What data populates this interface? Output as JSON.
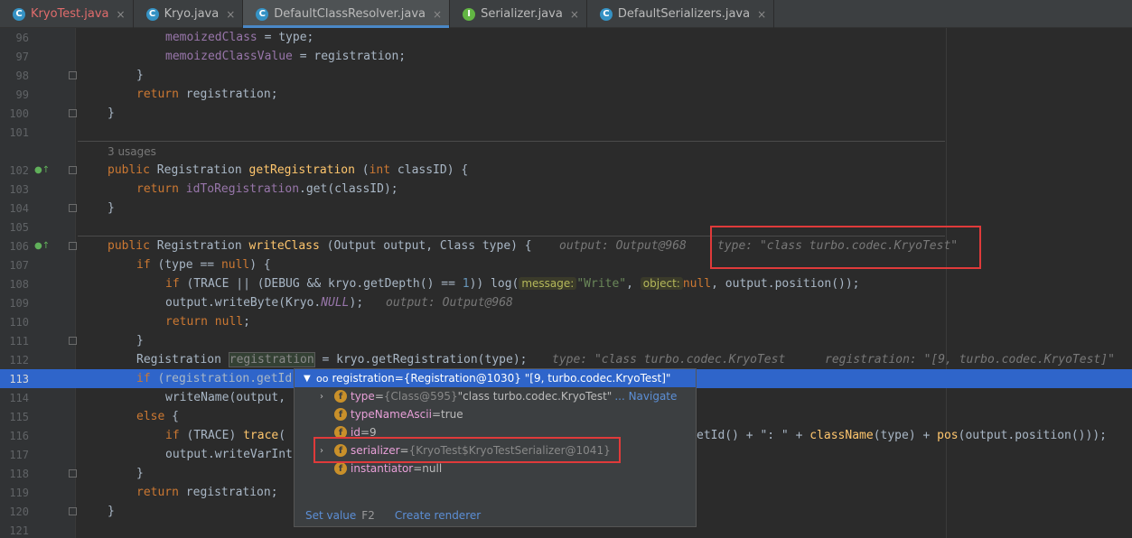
{
  "tabs": [
    {
      "label": "KryoTest.java",
      "icon": "C",
      "kind": "class",
      "error": true,
      "active": false
    },
    {
      "label": "Kryo.java",
      "icon": "C",
      "kind": "class",
      "error": false,
      "active": false
    },
    {
      "label": "DefaultClassResolver.java",
      "icon": "C",
      "kind": "class",
      "error": false,
      "active": true
    },
    {
      "label": "Serializer.java",
      "icon": "I",
      "kind": "interface",
      "error": false,
      "active": false
    },
    {
      "label": "DefaultSerializers.java",
      "icon": "C",
      "kind": "class",
      "error": false,
      "active": false
    }
  ],
  "tab_close_glyph": "×",
  "lines": {
    "96": "96",
    "97": "97",
    "98": "98",
    "99": "99",
    "100": "100",
    "101": "101",
    "102": "102",
    "103": "103",
    "104": "104",
    "105": "105",
    "106": "106",
    "107": "107",
    "108": "108",
    "109": "109",
    "110": "110",
    "111": "111",
    "112": "112",
    "113": "113",
    "114": "114",
    "115": "115",
    "116": "116",
    "117": "117",
    "118": "118",
    "119": "119",
    "120": "120",
    "121": "121"
  },
  "code": {
    "l96": {
      "a": "memoizedClass",
      "b": " = ",
      "c": "type",
      "d": ";"
    },
    "l97": {
      "a": "memoizedClassValue",
      "b": " = ",
      "c": "registration",
      "d": ";"
    },
    "l98": "}",
    "l99": {
      "kw": "return",
      "rest": " registration;"
    },
    "l100": "}",
    "usages": "3 usages",
    "l102": {
      "kw": "public",
      "t": " Registration ",
      "fn": "getRegistration",
      "p1": " (",
      "kw2": "int",
      "p2": " classID) {"
    },
    "l103": {
      "kw": "return",
      "sp": " ",
      "fld": "idToRegistration",
      "rest": ".get(classID);"
    },
    "l104": "}",
    "l106": {
      "kw": "public",
      "t": " Registration ",
      "fn": "writeClass",
      "p": " (Output output, Class type) {",
      "hint1": "output: Output@968",
      "hint2": "type: \"class turbo.codec.KryoTest\""
    },
    "l107": {
      "kw": "if",
      "p1": " (type == ",
      "kw2": "null",
      "p2": ") {"
    },
    "l108": {
      "kw": "if",
      "p1": " (TRACE || (DEBUG && kryo.getDepth() == ",
      "num": "1",
      "p2": ")) log(",
      "ph1": "message:",
      "str1": "\"Write\"",
      "c": ", ",
      "ph2": "object:",
      "kw2": "null",
      "p3": ", output.position());"
    },
    "l109": {
      "p1": "output.writeByte(Kryo.",
      "stat": "NULL",
      "p2": ");",
      "hint": "output: Output@968"
    },
    "l110": {
      "kw": "return",
      "sp": " ",
      "kw2": "null",
      "p": ";"
    },
    "l111": "}",
    "l112": {
      "t": "Registration ",
      "hl": "registration",
      "p": " = kryo.getRegistration(type);",
      "hint1": "type: \"class turbo.codec.KryoTest",
      "hint2": "registration: \"[9, turbo.codec.KryoTest]\""
    },
    "l113": {
      "kw": "if",
      "p": " (registration.getId"
    },
    "l114": "writeName(output,",
    "l115": {
      "kw": "else",
      "p": " {"
    },
    "l116": {
      "kw": "if",
      "p1": " (TRACE) ",
      "fn": "trace",
      "p2": "(",
      "tail": "etId() + \": \" + ",
      "fn2": "className",
      "tail2": "(type) + ",
      "fn3": "pos",
      "tail3": "(output.position()));"
    },
    "l117": "output.writeVarInt",
    "l118": "}",
    "l119": {
      "kw": "return",
      "rest": " registration;"
    },
    "l120": "}"
  },
  "popup": {
    "root": {
      "name": "registration",
      "eq": " = ",
      "value": "{Registration@1030} \"[9, turbo.codec.KryoTest]\""
    },
    "fields": [
      {
        "icon": "f",
        "name": "type",
        "eq": " = ",
        "ref": "{Class@595}",
        "value": " \"class turbo.codec.KryoTest\"",
        "link": "... Navigate",
        "expandable": true
      },
      {
        "icon": "f",
        "name": "typeNameAscii",
        "eq": " = ",
        "ref": "",
        "value": "true",
        "link": "",
        "expandable": false
      },
      {
        "icon": "f",
        "name": "id",
        "eq": " = ",
        "ref": "",
        "value": "9",
        "link": "",
        "expandable": false
      },
      {
        "icon": "f",
        "name": "serializer",
        "eq": " = ",
        "ref": "{KryoTest$KryoTestSerializer@1041}",
        "value": "",
        "link": "",
        "expandable": true
      },
      {
        "icon": "f",
        "name": "instantiator",
        "eq": " = ",
        "ref": "",
        "value": "null",
        "link": "",
        "expandable": false
      }
    ],
    "footer": {
      "set_value": "Set value",
      "set_value_key": "F2",
      "create_renderer": "Create renderer"
    }
  },
  "colors": {
    "accent": "#2f65ca",
    "highlight_box": "#e03a3a",
    "keyword": "#cc7832",
    "function": "#ffc66d"
  }
}
